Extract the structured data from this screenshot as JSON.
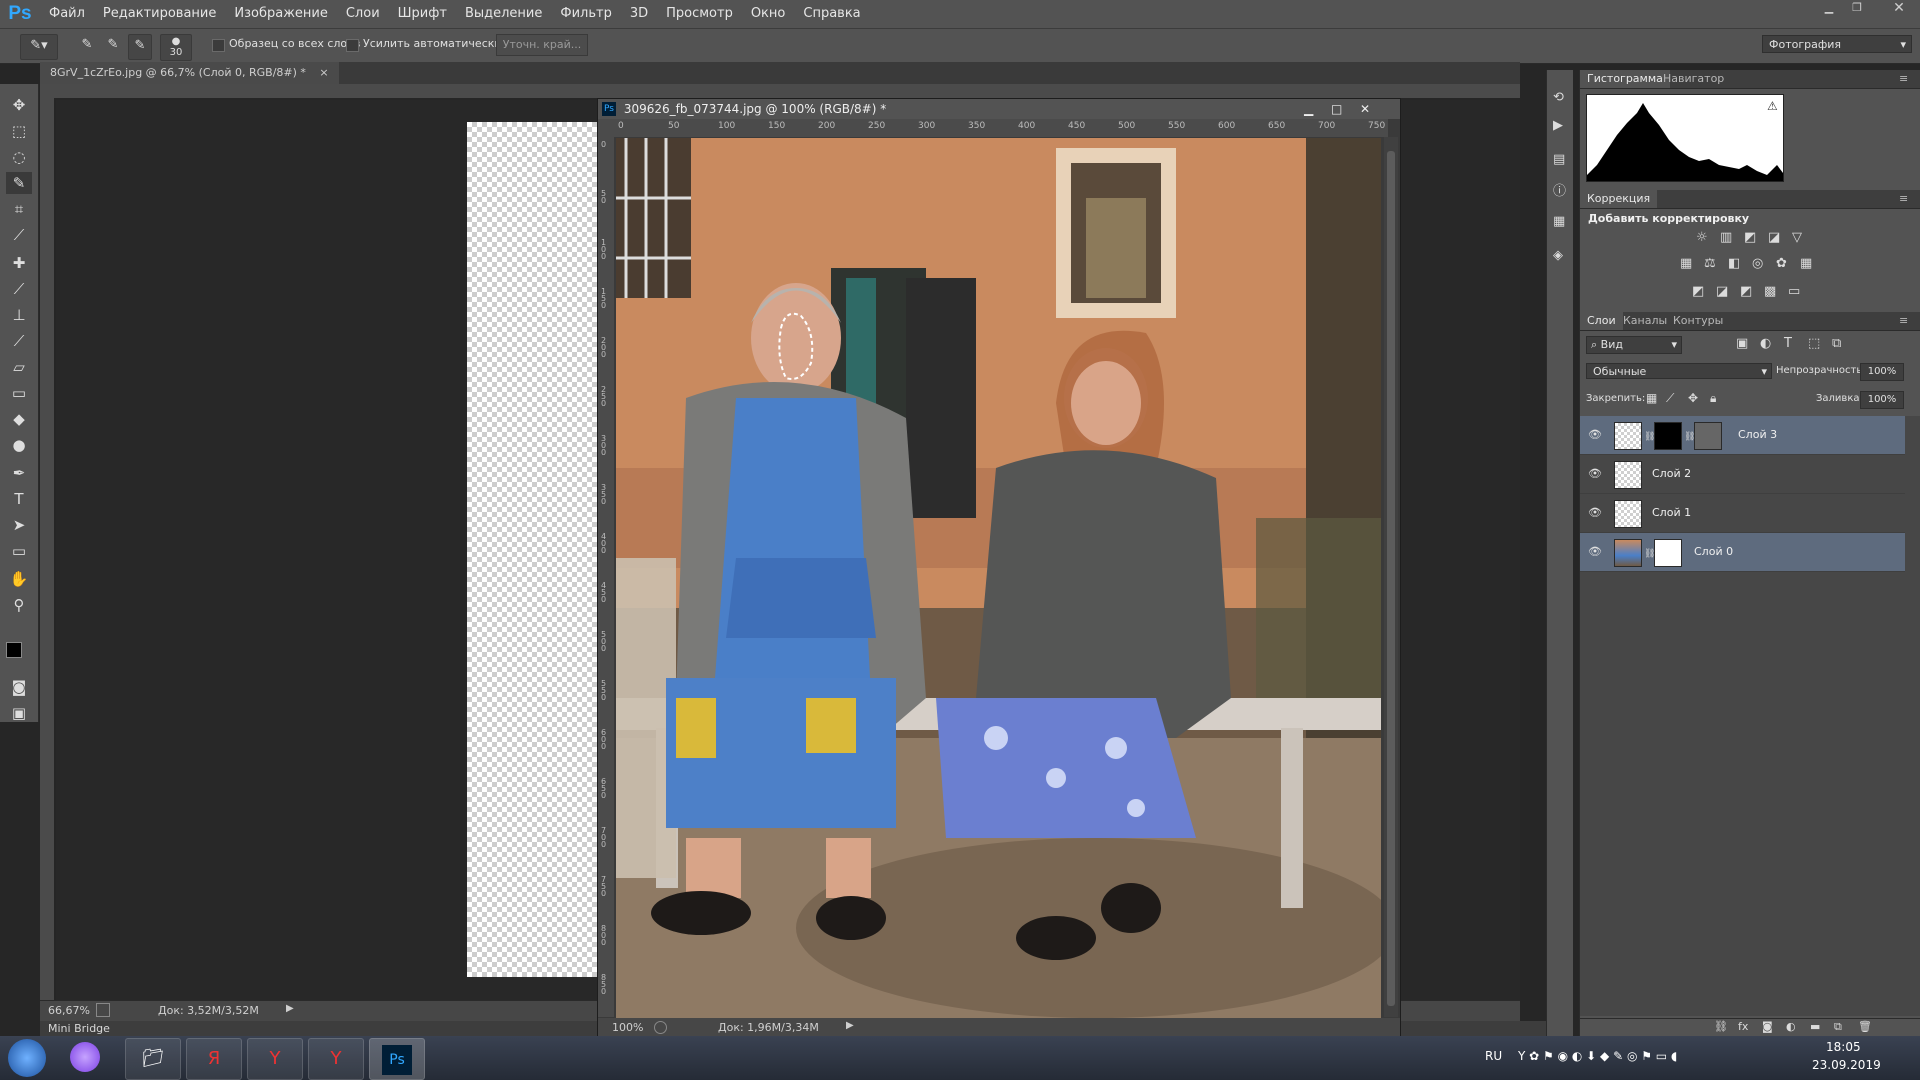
{
  "app": {
    "logo": "Ps",
    "menu": [
      "Файл",
      "Редактирование",
      "Изображение",
      "Слои",
      "Шрифт",
      "Выделение",
      "Фильтр",
      "3D",
      "Просмотр",
      "Окно",
      "Справка"
    ],
    "workspace": "Фотография"
  },
  "options": {
    "brush_size": "30",
    "sample_all_layers": "Образец со всех слоев",
    "auto_enhance": "Усилить автоматически",
    "refine_edge": "Уточн. край..."
  },
  "doc_tab": {
    "title": "8GrV_1cZrEo.jpg @ 66,7% (Слой 0, RGB/8#) *",
    "close": "×"
  },
  "status_main": {
    "zoom": "66,67%",
    "doc": "Док: 3,52M/3,52M"
  },
  "mini_bridge": "Mini Bridge",
  "float_doc": {
    "logo": "Ps",
    "title": "309626_fb_073744.jpg @ 100% (RGB/8#) *",
    "zoom": "100%",
    "doc": "Док: 1,96M/3,34M",
    "ruler_h": [
      "0",
      "50",
      "100",
      "150",
      "200",
      "250",
      "300",
      "350",
      "400",
      "450",
      "500",
      "550",
      "600",
      "650",
      "700",
      "750"
    ],
    "ruler_v": [
      "0",
      "5 0",
      "1 0 0",
      "1 5 0",
      "2 0 0",
      "2 5 0",
      "3 0 0",
      "3 5 0",
      "4 0 0",
      "4 5 0",
      "5 0 0",
      "5 5 0",
      "6 0 0",
      "6 5 0",
      "7 0 0",
      "7 5 0",
      "8 0 0",
      "8 5 0"
    ]
  },
  "panels": {
    "histogram_tabs": [
      "Гистограмма",
      "Навигатор"
    ],
    "correction_tab": "Коррекция",
    "add_adjustment": "Добавить корректировку",
    "layer_tabs": [
      "Слои",
      "Каналы",
      "Контуры"
    ],
    "filter_kind": "Вид",
    "blend_mode": "Обычные",
    "opacity_label": "Непрозрачность:",
    "opacity_value": "100%",
    "lock_label": "Закрепить:",
    "fill_label": "Заливка:",
    "fill_value": "100%",
    "layers": [
      {
        "name": "Слой 3",
        "selected": true
      },
      {
        "name": "Слой 2",
        "selected": false
      },
      {
        "name": "Слой 1",
        "selected": false
      },
      {
        "name": "Слой 0",
        "selected": true
      }
    ]
  },
  "taskbar": {
    "lang": "RU",
    "time": "18:05",
    "date": "23.09.2019"
  },
  "colors": {
    "ui_gray": "#535353",
    "selected_layer": "#5e6b7e",
    "ps_blue": "#31a8ff"
  }
}
